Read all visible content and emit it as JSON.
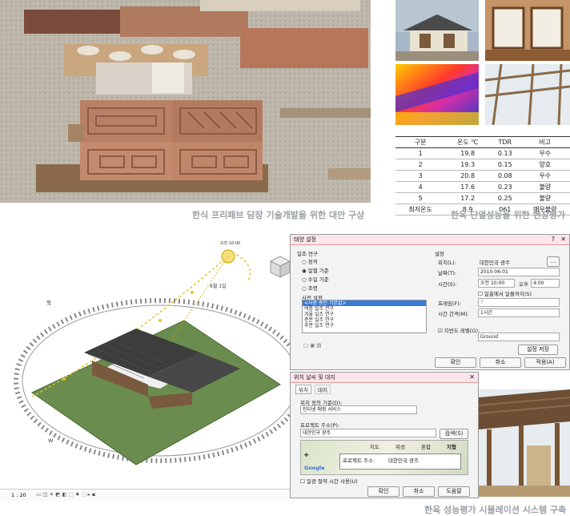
{
  "captions": {
    "top_left": "한식 프리패브 담장 기술개발을 위한 대안 구상",
    "top_right": "한옥 단열성능을 위한 현장평가",
    "bottom": "한옥 성능평가 시뮬레이션 시스템 구축"
  },
  "tdr_table": {
    "headers": [
      "구분",
      "온도 ℃",
      "TDR",
      "비고"
    ],
    "rows": [
      [
        "1",
        "19.8",
        "0.13",
        "우수"
      ],
      [
        "2",
        "19.3",
        "0.15",
        "양호"
      ],
      [
        "3",
        "20.8",
        "0.08",
        "우수"
      ],
      [
        "4",
        "17.6",
        "0.23",
        "불량"
      ],
      [
        "5",
        "17.2",
        "0.25",
        "불량"
      ],
      [
        "최저온도",
        "8.9",
        "061",
        "매우불량"
      ]
    ]
  },
  "revit": {
    "scale": "1 : 20",
    "compass_n": "북",
    "compass_w": "W",
    "sun_label": "오전 10:00",
    "date_label": "6월 1일"
  },
  "sun_dialog": {
    "title": "태양 설정",
    "study_title": "일조 연구",
    "study_options": [
      "정적",
      "일별 기준",
      "수일 기준",
      "조명"
    ],
    "presets_title": "사전 설정",
    "presets": [
      "<사용 중인 기본값>",
      "여름 일조 연구",
      "겨울 일조 연구",
      "춘분 일조 연구",
      "추분 일조 연구"
    ],
    "settings_title": "설정",
    "location_label": "위치(L):",
    "location_value": "대한민국 광주",
    "date_label": "날짜(T):",
    "date_value": "2010-06-01",
    "time_label": "시간(S):",
    "time_start": "오전 10:00",
    "time_to": "오후",
    "time_end": "4:00",
    "sunrise_label": "일출에서 일몰까지(S)",
    "frame_label": "프레임(F):",
    "frame_value": "7",
    "interval_label": "시간 간격(M):",
    "interval_value": "1시간",
    "ground_label": "지반도 레벨(G):",
    "ground_value": "Ground",
    "save_settings": "설정 저장",
    "ok": "확인",
    "cancel": "취소",
    "apply": "적용(A)"
  },
  "location_dialog": {
    "title": "위치 날씨 및 대지",
    "tabs": [
      "위치",
      "대지"
    ],
    "basis_label": "위치 정의 기준(D):",
    "basis_value": "인터넷 매핑 서비스",
    "address_label": "프로젝트 주소(P):",
    "address_value": "대한민국 광주",
    "search": "검색(S)",
    "map_tabs": [
      "지도",
      "위성",
      "혼합",
      "지형"
    ],
    "map_addr_label": "프로젝트 주소:",
    "map_addr_value": "대한민국 광주",
    "dst_label": "일광 절약 시간 사용(U)",
    "ok": "확인",
    "cancel": "취소",
    "help": "도움말"
  },
  "colors": {
    "ground": "#6a8c4e",
    "dialog_title": "#fbe4ea",
    "caption": "#9aa0a6"
  }
}
